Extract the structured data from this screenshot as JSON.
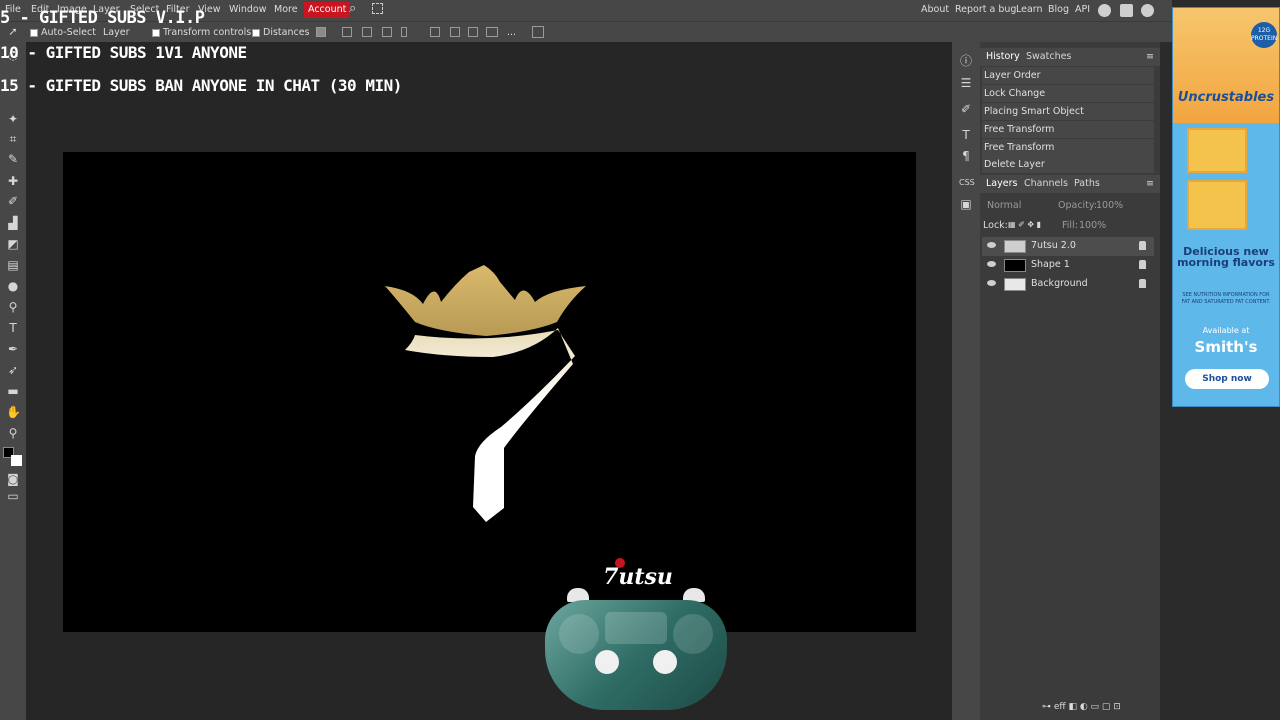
{
  "menubar": {
    "items": [
      "File",
      "Edit",
      "Image",
      "Layer",
      "Select",
      "Filter",
      "View",
      "Window",
      "More"
    ],
    "account": "Account",
    "right_links": [
      "About",
      "Report a bug",
      "Learn",
      "Blog",
      "API"
    ]
  },
  "options": {
    "auto_select_label": "Auto-Select",
    "auto_select_value": "Layer",
    "transform_controls": "Transform controls",
    "distances": "Distances"
  },
  "overlay": {
    "line1": "5 - GIFTED SUBS V.I.P",
    "line2": "10 - GIFTED SUBS 1V1 ANYONE",
    "line3": "15 - GIFTED SUBS BAN ANYONE IN CHAT (30 MIN)",
    "brand": "7utsu"
  },
  "history": {
    "tabs": [
      "History",
      "Swatches"
    ],
    "items": [
      "Layer Order",
      "Lock Change",
      "Placing Smart Object",
      "Free Transform",
      "Free Transform",
      "Delete Layer"
    ]
  },
  "layers": {
    "tabs": [
      "Layers",
      "Channels",
      "Paths"
    ],
    "blend_mode": "Normal",
    "opacity_label": "Opacity:",
    "opacity_value": "100%",
    "lock_label": "Lock:",
    "fill_label": "Fill:",
    "fill_value": "100%",
    "items": [
      "7utsu 2.0",
      "Shape 1",
      "Background"
    ]
  },
  "ad": {
    "badge": "12G PROTEIN",
    "brand": "Uncrustables",
    "headline": "Delicious new morning flavors",
    "disclaimer": "SEE NUTRITION INFORMATION FOR FAT AND SATURATED FAT CONTENT.",
    "available": "Available at",
    "store": "Smith's",
    "cta": "Shop now"
  },
  "colors": {
    "accent": "#c8151f",
    "canvas": "#000000",
    "gold": "#c9a85a",
    "ad_blue": "#5fb8ea"
  }
}
